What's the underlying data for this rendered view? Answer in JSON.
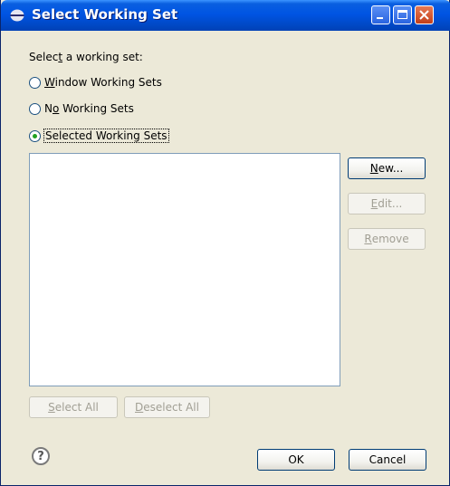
{
  "window": {
    "title": "Select Working Set"
  },
  "dialog": {
    "prompt_pre": "Selec",
    "prompt_accel": "t",
    "prompt_post": " a working set:",
    "radios": [
      {
        "accel": "W",
        "rest": "indow Working Sets",
        "selected": false
      },
      {
        "pre": "N",
        "accel": "o",
        "rest": " Working Sets",
        "selected": false
      },
      {
        "accel": "",
        "rest": "Selected Working Sets",
        "selected": true
      }
    ]
  },
  "buttons": {
    "new": {
      "accel": "N",
      "rest": "ew...",
      "enabled": true
    },
    "edit": {
      "accel": "E",
      "rest": "dit...",
      "enabled": false
    },
    "remove": {
      "accel": "R",
      "rest": "emove",
      "enabled": false
    },
    "select_all": {
      "accel": "S",
      "rest": "elect All",
      "enabled": false
    },
    "deselect_all": {
      "accel": "D",
      "rest": "eselect All",
      "enabled": false
    },
    "ok": "OK",
    "cancel": "Cancel"
  },
  "help": {
    "glyph": "?"
  },
  "colors": {
    "titlebar": "#0054e3",
    "dialog_bg": "#ece9d8",
    "radio_dot": "#21a121"
  }
}
